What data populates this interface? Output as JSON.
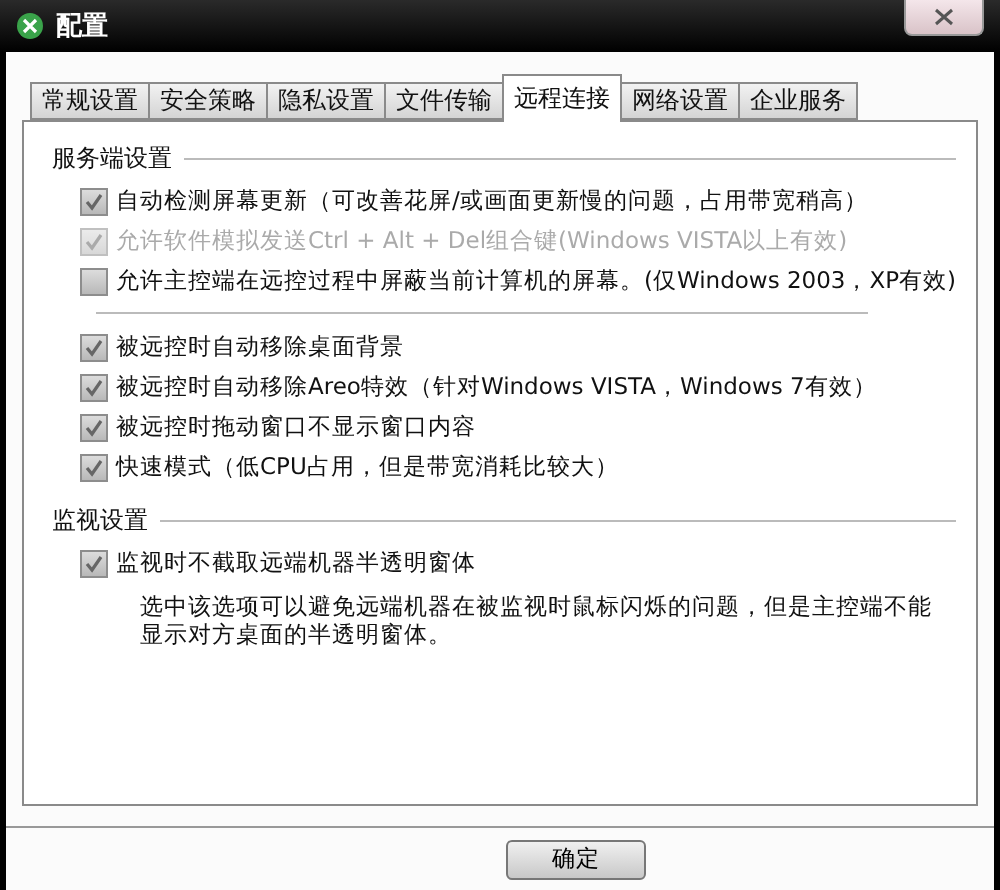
{
  "window": {
    "title": "配置"
  },
  "tabs": [
    {
      "label": "常规设置",
      "selected": false
    },
    {
      "label": "安全策略",
      "selected": false
    },
    {
      "label": "隐私设置",
      "selected": false
    },
    {
      "label": "文件传输",
      "selected": false
    },
    {
      "label": "远程连接",
      "selected": true
    },
    {
      "label": "网络设置",
      "selected": false
    },
    {
      "label": "企业服务",
      "selected": false
    }
  ],
  "sections": [
    {
      "title": "服务端设置",
      "groups": [
        [
          {
            "label": "自动检测屏幕更新（可改善花屏/或画面更新慢的问题，占用带宽稍高）",
            "checked": true,
            "disabled": false
          },
          {
            "label": "允许软件模拟发送Ctrl + Alt + Del组合键(Windows VISTA以上有效)",
            "checked": true,
            "disabled": true
          },
          {
            "label": "允许主控端在远控过程中屏蔽当前计算机的屏幕。(仅Windows 2003，XP有效)",
            "checked": false,
            "disabled": false
          }
        ],
        [
          {
            "label": "被远控时自动移除桌面背景",
            "checked": true,
            "disabled": false
          },
          {
            "label": "被远控时自动移除Areo特效（针对Windows VISTA，Windows 7有效）",
            "checked": true,
            "disabled": false
          },
          {
            "label": "被远控时拖动窗口不显示窗口内容",
            "checked": true,
            "disabled": false
          },
          {
            "label": "快速模式（低CPU占用，但是带宽消耗比较大）",
            "checked": true,
            "disabled": false
          }
        ]
      ]
    },
    {
      "title": "监视设置",
      "groups": [
        [
          {
            "label": "监视时不截取远端机器半透明窗体",
            "checked": true,
            "disabled": false,
            "description": "选中该选项可以避免远端机器在被监视时鼠标闪烁的问题，但是主控端不能显示对方桌面的半透明窗体。"
          }
        ]
      ]
    }
  ],
  "buttons": [
    "确定"
  ]
}
